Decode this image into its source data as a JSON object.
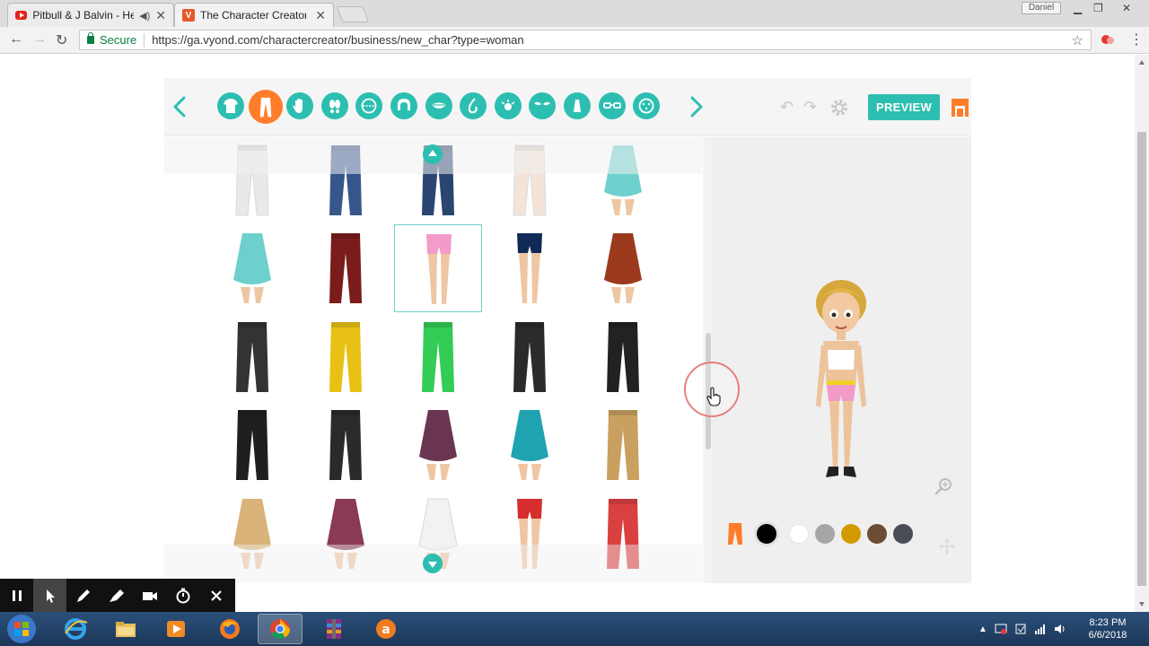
{
  "browser": {
    "tabs": [
      {
        "title": "Pitbull & J Balvin - He",
        "favicon": "youtube-icon",
        "audio": true
      },
      {
        "title": "The Character Creator fro",
        "favicon": "vyond-icon",
        "active": true
      }
    ],
    "user": "Daniel",
    "secure_label": "Secure",
    "url": "https://ga.vyond.com/charactercreator/business/new_char?type=woman"
  },
  "creator": {
    "categories": [
      "shirt-icon",
      "pants-icon",
      "hand-icon",
      "feet-icon",
      "face-shape-icon",
      "hair-icon",
      "mouth-icon",
      "nose-icon",
      "eye-icon",
      "eyebrow-icon",
      "beard-icon",
      "glasses-icon",
      "makeup-icon"
    ],
    "active_category": "pants-icon",
    "preview_label": "PREVIEW",
    "bottom_items": [
      {
        "type": "pants",
        "color": "#e9e9e9"
      },
      {
        "type": "pants",
        "color": "#36568c"
      },
      {
        "type": "pants",
        "color": "#2a4570"
      },
      {
        "type": "pants",
        "color": "#f4e4d8"
      },
      {
        "type": "skirt",
        "color": "#6dd0cd"
      },
      {
        "type": "skirt",
        "color": "#6dd0cd"
      },
      {
        "type": "pants",
        "color": "#7a1c1c"
      },
      {
        "type": "shorts",
        "color": "#f29bc8",
        "selected": true
      },
      {
        "type": "shorts",
        "color": "#0f2a55"
      },
      {
        "type": "skirt",
        "color": "#9b3a1d"
      },
      {
        "type": "pants",
        "color": "#333333"
      },
      {
        "type": "pants",
        "color": "#e8c114"
      },
      {
        "type": "pants",
        "color": "#33cc55"
      },
      {
        "type": "pants",
        "color": "#2b2b2b"
      },
      {
        "type": "pants",
        "color": "#222222"
      },
      {
        "type": "pants",
        "color": "#1f1f1f"
      },
      {
        "type": "pants",
        "color": "#2a2a2a"
      },
      {
        "type": "skirt",
        "color": "#6a3550"
      },
      {
        "type": "skirt",
        "color": "#1fa3b0"
      },
      {
        "type": "pants",
        "color": "#c9a060"
      },
      {
        "type": "skirt",
        "color": "#d9b37a"
      },
      {
        "type": "skirt",
        "color": "#8a3a55"
      },
      {
        "type": "skirt",
        "color": "#f2f2f2"
      },
      {
        "type": "shorts",
        "color": "#d62e2e"
      },
      {
        "type": "pants",
        "color": "#d94040"
      }
    ],
    "swatches": [
      "#000000",
      "#ffffff",
      "#a6a6a6",
      "#d19a00",
      "#6b4c34",
      "#4a4d56"
    ],
    "selected_swatch": "#000000"
  },
  "taskbar": {
    "apps": [
      "internet-explorer-icon",
      "file-explorer-icon",
      "media-player-icon",
      "firefox-icon",
      "chrome-icon",
      "winrar-icon",
      "avast-icon"
    ],
    "active_app": "chrome-icon",
    "time": "8:23 PM",
    "date": "6/6/2018"
  }
}
